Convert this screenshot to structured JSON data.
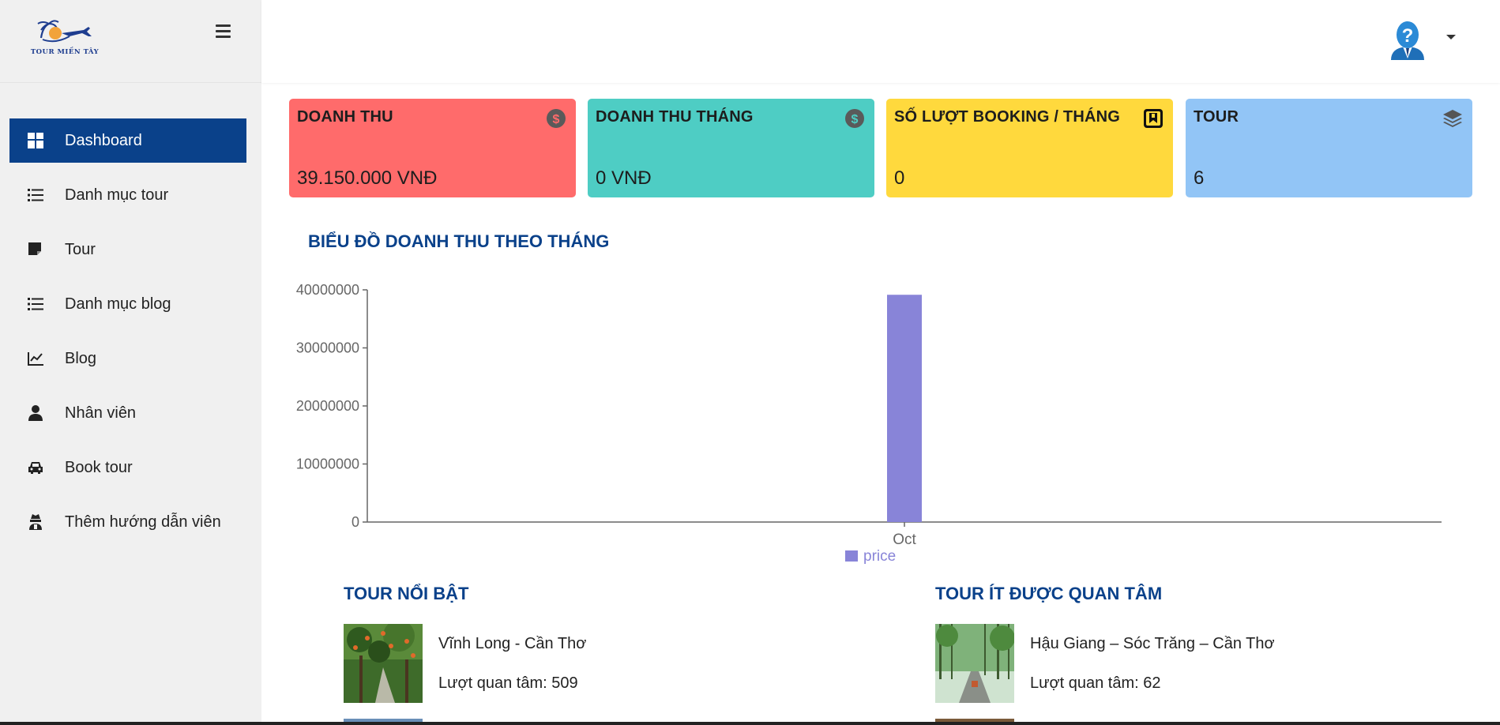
{
  "logo": {
    "text": "TOUR MIỀN TÂY"
  },
  "sidebar": {
    "items": [
      {
        "label": "Dashboard",
        "icon": "grid-icon",
        "active": true
      },
      {
        "label": "Danh mục tour",
        "icon": "list-icon"
      },
      {
        "label": "Tour",
        "icon": "sticky-note-icon"
      },
      {
        "label": "Danh mục blog",
        "icon": "list-icon"
      },
      {
        "label": "Blog",
        "icon": "chart-line-icon"
      },
      {
        "label": "Nhân viên",
        "icon": "user-icon"
      },
      {
        "label": "Book tour",
        "icon": "car-icon"
      },
      {
        "label": "Thêm hướng dẫn viên",
        "icon": "user-secret-icon"
      }
    ]
  },
  "cards": [
    {
      "title": "DOANH THU",
      "value": "39.150.000 VNĐ",
      "color": "#ff6b6b",
      "icon": "dollar-circle-icon"
    },
    {
      "title": "DOANH THU THÁNG",
      "value": "0 VNĐ",
      "color": "#4ecdc4",
      "icon": "dollar-circle-icon"
    },
    {
      "title": "SỐ LƯỢT BOOKING / THÁNG",
      "value": "0",
      "color": "#ffd93d",
      "icon": "booking-icon"
    },
    {
      "title": "TOUR",
      "value": "6",
      "color": "#92c5f6",
      "icon": "layers-icon"
    }
  ],
  "chart_section": {
    "title": "BIỂU ĐỒ DOANH THU THEO THÁNG"
  },
  "chart_data": {
    "type": "bar",
    "categories": [
      "Oct"
    ],
    "series": [
      {
        "name": "price",
        "values": [
          39150000
        ],
        "color": "#8884d8"
      }
    ],
    "yticks": [
      0,
      10000000,
      20000000,
      30000000,
      40000000
    ],
    "ylim": [
      0,
      40000000
    ],
    "legend": "bottom-center"
  },
  "featured": {
    "title": "TOUR NỔI BẬT",
    "items": [
      {
        "name": "Vĩnh Long - Cần Thơ",
        "views": "Lượt quan tâm: 509"
      }
    ]
  },
  "least": {
    "title": "TOUR ÍT ĐƯỢC QUAN TÂM",
    "items": [
      {
        "name": "Hậu Giang – Sóc Trăng – Cần Thơ",
        "views": "Lượt quan tâm: 62"
      }
    ]
  }
}
